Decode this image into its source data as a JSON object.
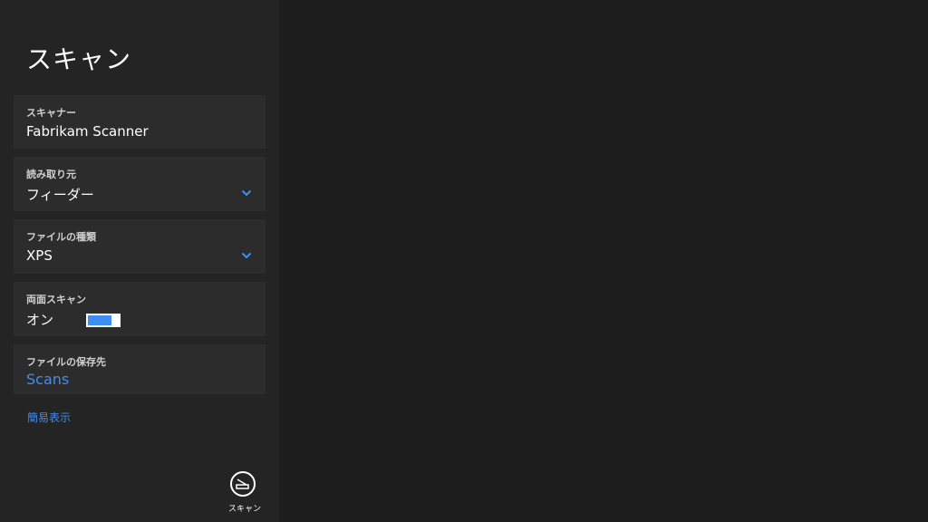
{
  "page": {
    "title": "スキャン"
  },
  "settings": {
    "scanner": {
      "label": "スキャナー",
      "value": "Fabrikam Scanner"
    },
    "source": {
      "label": "読み取り元",
      "value": "フィーダー"
    },
    "file_type": {
      "label": "ファイルの種類",
      "value": "XPS"
    },
    "duplex": {
      "label": "両面スキャン",
      "value": "オン",
      "on": true
    },
    "save_location": {
      "label": "ファイルの保存先",
      "value": "Scans"
    },
    "fewer_link": "簡易表示"
  },
  "app_bar": {
    "scan_label": "スキャン"
  },
  "colors": {
    "accent": "#3f8ef2",
    "pane": "#242424",
    "card": "#2c2c2c",
    "background": "#1d1d1d"
  },
  "icons": {
    "chevron": "chevron-down-icon",
    "scan": "scanner-icon"
  }
}
